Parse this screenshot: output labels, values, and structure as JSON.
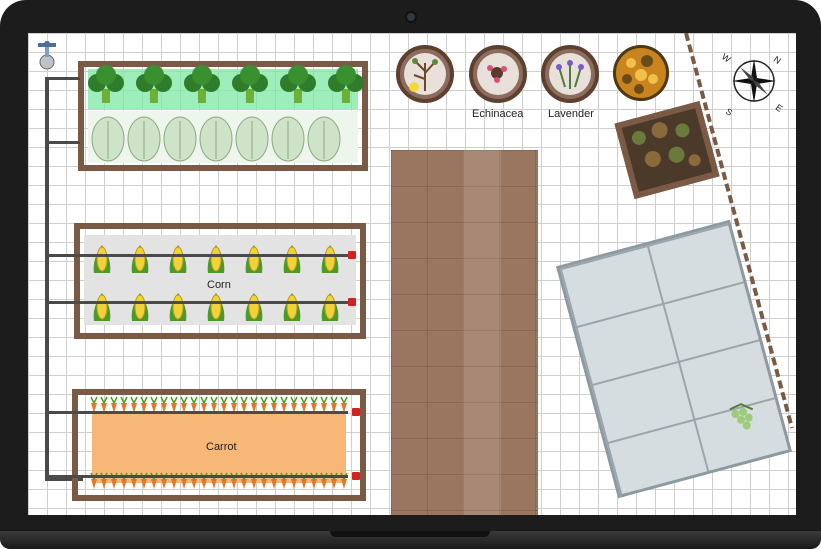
{
  "beds": {
    "corn_label": "Corn",
    "carrot_label": "Carrot"
  },
  "trees": [
    {
      "name": "lemon-tree",
      "label": ""
    },
    {
      "name": "echinacea",
      "label": "Echinacea"
    },
    {
      "name": "lavender",
      "label": "Lavender"
    },
    {
      "name": "shrub",
      "label": ""
    }
  ],
  "compass": {
    "n": "N",
    "e": "E",
    "s": "S",
    "w": "W"
  },
  "colors": {
    "wood": "#7a5a44",
    "drip_emitter": "#d42020",
    "broccoli_glow": "#7de8a4",
    "carrot_bed": "#f7b777",
    "corn_green": "#4a9a2a",
    "corn_yellow": "#f1d23a"
  }
}
